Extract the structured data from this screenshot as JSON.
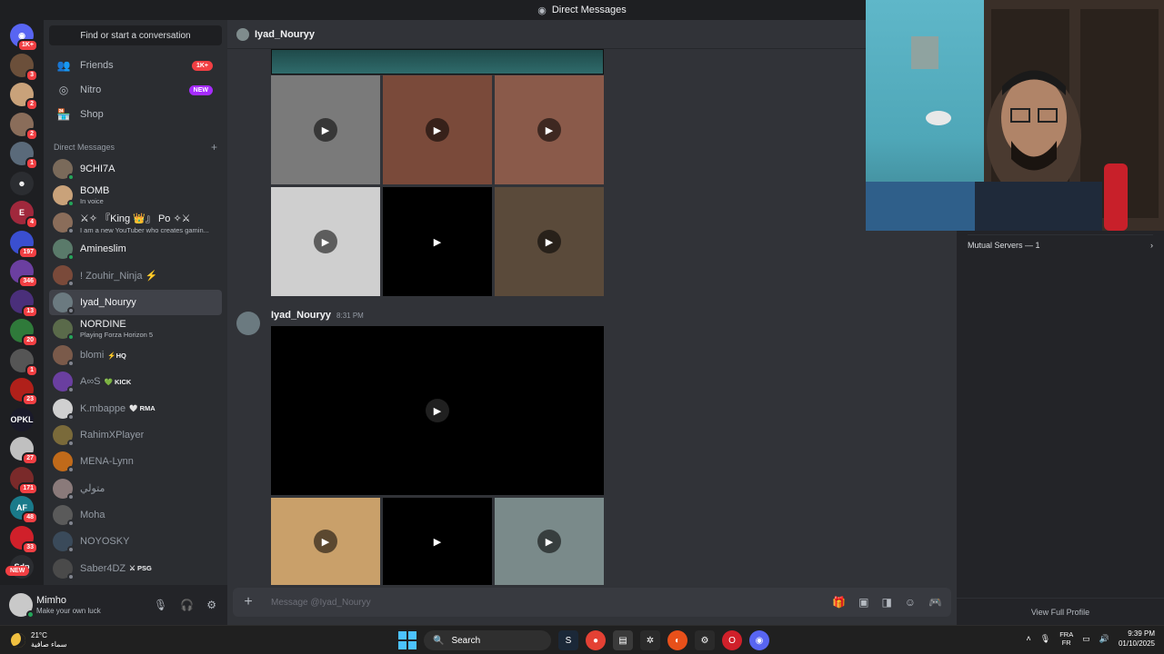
{
  "window": {
    "title": "Direct Messages"
  },
  "rail": {
    "servers": [
      {
        "badge": "1K+",
        "color": "#5865f2",
        "glyph": "◉"
      },
      {
        "badge": "3",
        "color": "#6b4f3a",
        "glyph": ""
      },
      {
        "badge": "2",
        "color": "#c9a27a",
        "glyph": ""
      },
      {
        "badge": "2",
        "color": "#8a6d5a",
        "glyph": ""
      },
      {
        "badge": "1",
        "color": "#5a6a7a",
        "glyph": ""
      },
      {
        "badge": "",
        "color": "#2b2d31",
        "glyph": "☻"
      },
      {
        "badge": "4",
        "color": "#a0283c",
        "glyph": "E"
      },
      {
        "badge": "197",
        "color": "#3a4fd0",
        "glyph": ""
      },
      {
        "badge": "346",
        "color": "#6b3fa0",
        "glyph": ""
      },
      {
        "badge": "13",
        "color": "#4a2f7a",
        "glyph": ""
      },
      {
        "badge": "20",
        "color": "#2f7a3a",
        "glyph": ""
      },
      {
        "badge": "1",
        "color": "#555",
        "glyph": ""
      },
      {
        "badge": "23",
        "color": "#b0201a",
        "glyph": ""
      },
      {
        "badge": "",
        "color": "#1a1a2a",
        "glyph": "OPKL"
      },
      {
        "badge": "27",
        "color": "#c0c0c0",
        "glyph": ""
      },
      {
        "badge": "171",
        "color": "#7a2a2a",
        "glyph": ""
      },
      {
        "badge": "48",
        "color": "#1a7a8a",
        "glyph": "AF"
      },
      {
        "badge": "33",
        "color": "#d0202a",
        "glyph": ""
      },
      {
        "badge": "",
        "color": "#2b2d31",
        "glyph": "Sdp"
      }
    ],
    "new_label": "NEW"
  },
  "sidebar": {
    "find_placeholder": "Find or start a conversation",
    "nav": [
      {
        "label": "Friends",
        "icon": "friends-icon",
        "tag": "1K+"
      },
      {
        "label": "Nitro",
        "icon": "nitro-icon",
        "tag": "NEW"
      },
      {
        "label": "Shop",
        "icon": "shop-icon",
        "tag": ""
      }
    ],
    "dm_header": "Direct Messages",
    "dms": [
      {
        "name": "9CHI7A",
        "sub": "",
        "chip": "",
        "color": "#7a6a5a",
        "online": true
      },
      {
        "name": "BOMB",
        "sub": "In voice",
        "chip": "",
        "color": "#c9a27a",
        "online": true
      },
      {
        "name": "⚔✧ 『King 👑』 Po ✧⚔",
        "sub": "I am a new YouTuber who creates gamin...",
        "chip": "",
        "color": "#8a6d5a",
        "online": false
      },
      {
        "name": "Amineslim",
        "sub": "",
        "chip": "",
        "color": "#5a7a6a",
        "online": true
      },
      {
        "name": "! Zouhir_Ninja ⚡",
        "sub": "",
        "chip": "",
        "color": "#7a4a3a",
        "online": false
      },
      {
        "name": "Iyad_Nouryy",
        "sub": "",
        "chip": "",
        "color": "#6b7a80",
        "online": false
      },
      {
        "name": "NORDINE",
        "sub": "Playing Forza Horizon 5",
        "chip": "",
        "color": "#5a6a4a",
        "online": true
      },
      {
        "name": "blomi",
        "sub": "",
        "chip": "⚡HQ",
        "color": "#7a5a4a",
        "online": false
      },
      {
        "name": "A∞S",
        "sub": "",
        "chip": "💚 KICK",
        "color": "#6a3fa0",
        "online": false
      },
      {
        "name": "K.mbappe",
        "sub": "",
        "chip": "🤍 RMA",
        "color": "#d0d0d0",
        "online": false
      },
      {
        "name": "RahimXPlayer",
        "sub": "",
        "chip": "",
        "color": "#7a6a3a",
        "online": false
      },
      {
        "name": "MENA-Lynn",
        "sub": "",
        "chip": "",
        "color": "#c06a1a",
        "online": false
      },
      {
        "name": "متولي",
        "sub": "",
        "chip": "",
        "color": "#8a7a7a",
        "online": false
      },
      {
        "name": "Moha",
        "sub": "",
        "chip": "",
        "color": "#5a5a5a",
        "online": false
      },
      {
        "name": "NOYOSKY",
        "sub": "",
        "chip": "",
        "color": "#3a4a5a",
        "online": false
      },
      {
        "name": "Saber4DZ",
        "sub": "",
        "chip": "⚔ PSG",
        "color": "#4a4a4a",
        "online": false
      }
    ]
  },
  "user": {
    "name": "Mimho",
    "status": "Make your own luck"
  },
  "chat": {
    "recipient": "Iyad_Nouryy",
    "message_author": "Iyad_Nouryy",
    "message_time": "8:31 PM",
    "composer_placeholder": "Message @Iyad_Nouryy",
    "grid_tiles": [
      {
        "bg": "#7a7a7a"
      },
      {
        "bg": "#7a4a3a"
      },
      {
        "bg": "#8a5a4a"
      },
      {
        "bg": "#cfcfcf"
      },
      {
        "bg": "#000000"
      },
      {
        "bg": "#5a4a3a"
      }
    ],
    "bottom_tiles": [
      {
        "bg": "#c9a06a"
      },
      {
        "bg": "#000000"
      },
      {
        "bg": "#7a8a8a"
      }
    ]
  },
  "profile": {
    "mutual_servers": "Mutual Servers — 1",
    "view_full": "View Full Profile"
  },
  "taskbar": {
    "temp": "21°C",
    "weather_text": "سماء صافية",
    "search_label": "Search",
    "lang_top": "FRA",
    "lang_bottom": "FR",
    "time": "9:39 PM",
    "date": "01/10/2025"
  }
}
